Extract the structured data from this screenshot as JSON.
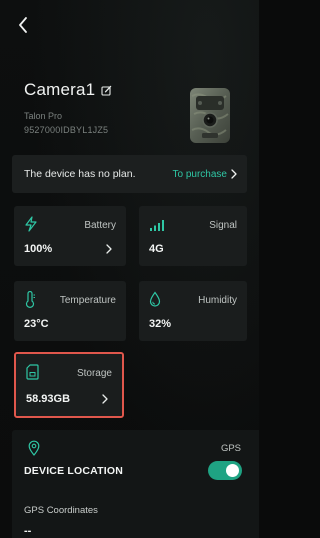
{
  "device": {
    "name": "Camera1",
    "model": "Talon Pro",
    "serial": "9527000IDBYL1JZ5"
  },
  "plan": {
    "message": "The device has no plan.",
    "action_label": "To purchase"
  },
  "cards": {
    "battery": {
      "label": "Battery",
      "value": "100%"
    },
    "signal": {
      "label": "Signal",
      "value": "4G"
    },
    "temperature": {
      "label": "Temperature",
      "value": "23°C"
    },
    "humidity": {
      "label": "Humidity",
      "value": "32%"
    },
    "storage": {
      "label": "Storage",
      "value": "58.93GB"
    }
  },
  "gps": {
    "label": "GPS",
    "title": "DEVICE LOCATION",
    "enabled": true,
    "coords_label": "GPS Coordinates",
    "coords_value": "--"
  },
  "colors": {
    "accent": "#2fc7a5",
    "toggle_on": "#1fa383",
    "highlight": "#e0574c",
    "card_bg": "#1a1d1d"
  },
  "icons": {
    "back": "chevron-left-icon",
    "edit": "edit-icon",
    "battery": "lightning-icon",
    "signal": "signal-bars-icon",
    "temperature": "thermometer-icon",
    "humidity": "water-drop-icon",
    "storage": "sd-card-icon",
    "gps": "map-pin-icon"
  }
}
